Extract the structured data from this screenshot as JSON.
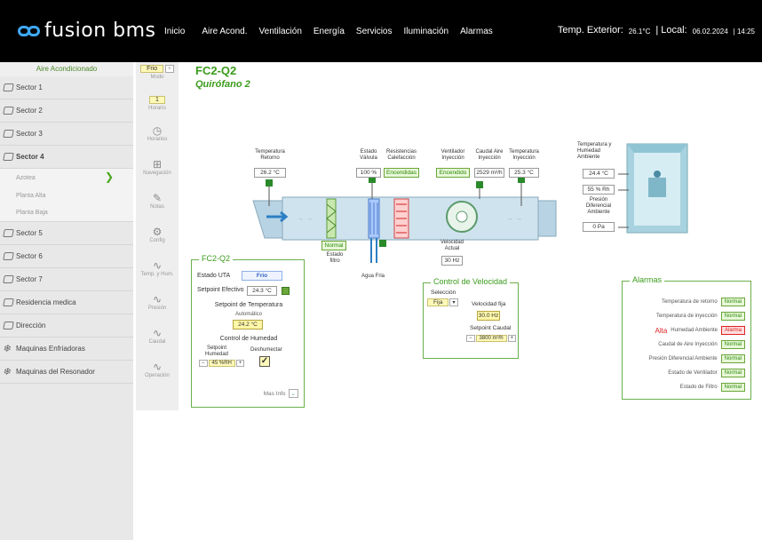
{
  "app": {
    "brand": "fusion bms"
  },
  "nav": [
    "Inicio",
    "Aire Acond.",
    "Ventilación",
    "Energía",
    "Servicios",
    "Iluminación",
    "Alarmas"
  ],
  "topinfo": {
    "temp_label": "Temp. Exterior:",
    "temp_value": "26.1°C",
    "local_label": "| Local:",
    "date": "06.02.2024",
    "time": "| 14:25"
  },
  "sidebar": {
    "header": "Aire Acondicionado",
    "items": [
      "Sector 1",
      "Sector 2",
      "Sector 3",
      "Sector 4"
    ],
    "sub": [
      "Azotea",
      "Planta Alta",
      "Planta Baja"
    ],
    "items2": [
      "Sector 5",
      "Sector 6",
      "Sector 7",
      "Residencia medica",
      "Dirección",
      "Maquinas Enfriadoras",
      "Maquinas del Resonador"
    ]
  },
  "tools": {
    "mode_value": "Frio",
    "mode_label": "Modo",
    "horario_value": "1",
    "horario_label": "Horario",
    "items": [
      "Horarios",
      "Navegación",
      "Notas",
      "Config",
      "Temp. y Hum.",
      "Presión",
      "Caudal",
      "Operación"
    ]
  },
  "main": {
    "title": "FC2-Q2",
    "subtitle": "Quirófano 2",
    "temp_retorno_label": "Temperatura Retorno",
    "temp_retorno": "26.2 °C",
    "estado_valvula_label": "Estado Válvula",
    "estado_valvula": "100 %",
    "resistencias_label": "Resistencias Calefacción",
    "resistencias": "Encendidas",
    "ventilador_label": "Ventilador Inyección",
    "ventilador": "Encendido",
    "caudal_label": "Caudal Aire Inyección",
    "caudal": "2529 m³/h",
    "temp_inyeccion_label": "Temperatura Inyección",
    "temp_inyeccion": "25.3 °C",
    "filtro_value": "Normal",
    "filtro_label": "Estado filtro",
    "agua_label": "Agua Fria",
    "velocidad_label": "Velocidad Actual",
    "velocidad": "30 Hz",
    "amb_label": "Temperatura y Humedad Ambiente",
    "amb_temp": "24.4 °C",
    "amb_hum": "55 % Rh",
    "presion_label": "Presión Diferencial Ambiente",
    "presion": "0 Pa"
  },
  "fc_box": {
    "title": "FC2-Q2",
    "estado_uta_label": "Estado UTA",
    "estado_uta": "Frio",
    "setpoint_label": "Setpoint Efectivo",
    "setpoint": "24.3 °C",
    "sp_temp_label": "Setpoint de Temperatura",
    "auto": "Automático",
    "sp_temp": "24.2 °C",
    "hum_label": "Control de Humedad",
    "sp_hum_label": "Setpoint Humedad",
    "deshum_label": "Deshumectar",
    "sp_hum": "45 %RH",
    "mas_info": "Mas Info"
  },
  "vel_box": {
    "title": "Control de Velocidad",
    "sel_label": "Selección",
    "sel_value": "Fija",
    "vel_fija_label": "Velocidad fija",
    "vel_fija": "30.0 Hz",
    "sp_caudal_label": "Setpoint Caudal",
    "sp_caudal": "3800 m³/h"
  },
  "alarms": {
    "title": "Alarmas",
    "rows": [
      {
        "prefix": "",
        "label": "Temperatura de retorno",
        "status": "Normal"
      },
      {
        "prefix": "",
        "label": "Temperatura de inyección",
        "status": "Normal"
      },
      {
        "prefix": "Alta",
        "label": "Humedad Ambiente",
        "status": "Alarma"
      },
      {
        "prefix": "",
        "label": "Caudal de Aire Inyección",
        "status": "Normal"
      },
      {
        "prefix": "",
        "label": "Presión Diferencial Ambiente",
        "status": "Normal"
      },
      {
        "prefix": "",
        "label": "Estado de Ventilador",
        "status": "Normal"
      },
      {
        "prefix": "",
        "label": "Estado de Filtro",
        "status": "Normal"
      }
    ]
  }
}
